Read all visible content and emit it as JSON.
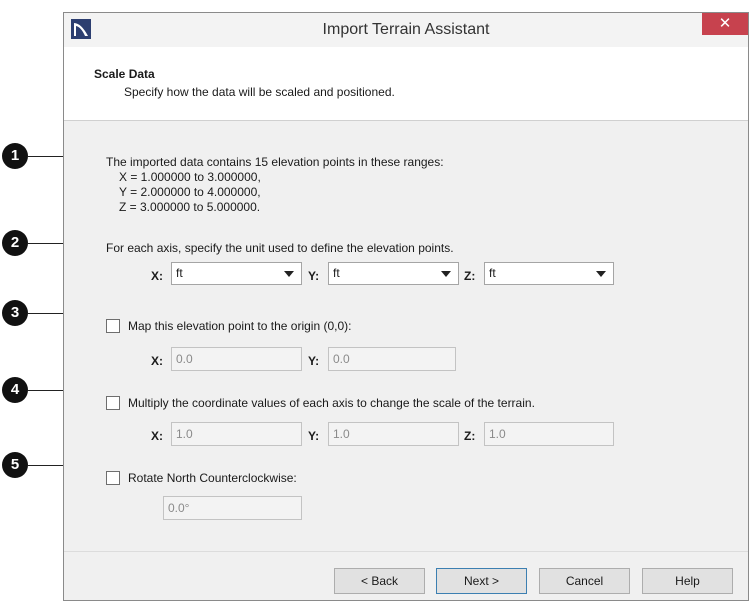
{
  "dialog": {
    "title": "Import Terrain Assistant",
    "close_glyph": "✕",
    "header_title": "Scale Data",
    "header_subtitle": "Specify how the data will be scaled and positioned."
  },
  "info": {
    "line1": "The imported data contains 15 elevation points in these ranges:",
    "line2": "X = 1.000000 to 3.000000,",
    "line3": "Y = 2.000000 to 4.000000,",
    "line4": "Z = 3.000000 to 5.000000."
  },
  "units": {
    "instruction": "For each axis, specify the unit used to define the elevation points.",
    "x_label": "X:",
    "x_value": "ft",
    "y_label": "Y:",
    "y_value": "ft",
    "z_label": "Z:",
    "z_value": "ft"
  },
  "origin": {
    "label": "Map this elevation point to the origin (0,0):",
    "checked": false,
    "x_label": "X:",
    "x_value": "0.0",
    "y_label": "Y:",
    "y_value": "0.0"
  },
  "scale": {
    "label": "Multiply the coordinate values of each axis to change the scale of the terrain.",
    "checked": false,
    "x_label": "X:",
    "x_value": "1.0",
    "y_label": "Y:",
    "y_value": "1.0",
    "z_label": "Z:",
    "z_value": "1.0"
  },
  "rotate": {
    "label": "Rotate North Counterclockwise:",
    "checked": false,
    "value": "0.0°"
  },
  "buttons": {
    "back": "< Back",
    "next": "Next >",
    "cancel": "Cancel",
    "help": "Help"
  },
  "callouts": [
    "1",
    "2",
    "3",
    "4",
    "5"
  ],
  "colors": {
    "close_button": "#c7424e",
    "default_button_border": "#3c7fb1",
    "callout_badge": "#111111"
  }
}
